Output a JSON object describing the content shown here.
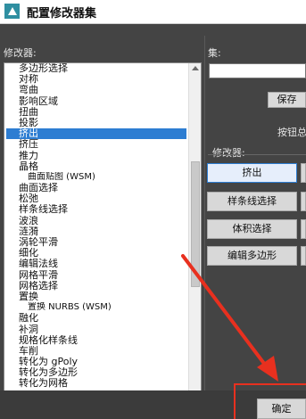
{
  "window": {
    "title": "配置修改器集"
  },
  "left_panel": {
    "label": "修改器:",
    "items": [
      "多边形选择",
      "对称",
      "弯曲",
      "影响区域",
      "扭曲",
      "投影",
      "挤出",
      "挤压",
      "推力",
      "晶格",
      "曲面贴图 (WSM)",
      "曲面选择",
      "松弛",
      "样条线选择",
      "波浪",
      "涟漪",
      "涡轮平滑",
      "细化",
      "编辑法线",
      "网格平滑",
      "网格选择",
      "置换",
      "置换 NURBS (WSM)",
      "融化",
      "补洞",
      "规格化样条线",
      "车削",
      "转化为 gPoly",
      "转化为多边形",
      "转化为网格"
    ]
  },
  "right_panel": {
    "set_label": "集:",
    "set_value": "",
    "save_label": "保存",
    "total_label": "按钮总",
    "modifiers_label": "修改器:",
    "buttons": [
      "挤出",
      "样条线选择",
      "体积选择",
      "编辑多边形"
    ]
  },
  "footer": {
    "ok_label": "确定"
  },
  "colors": {
    "annotation_red": "#e8301f",
    "selection_blue": "#2d7dd2"
  }
}
